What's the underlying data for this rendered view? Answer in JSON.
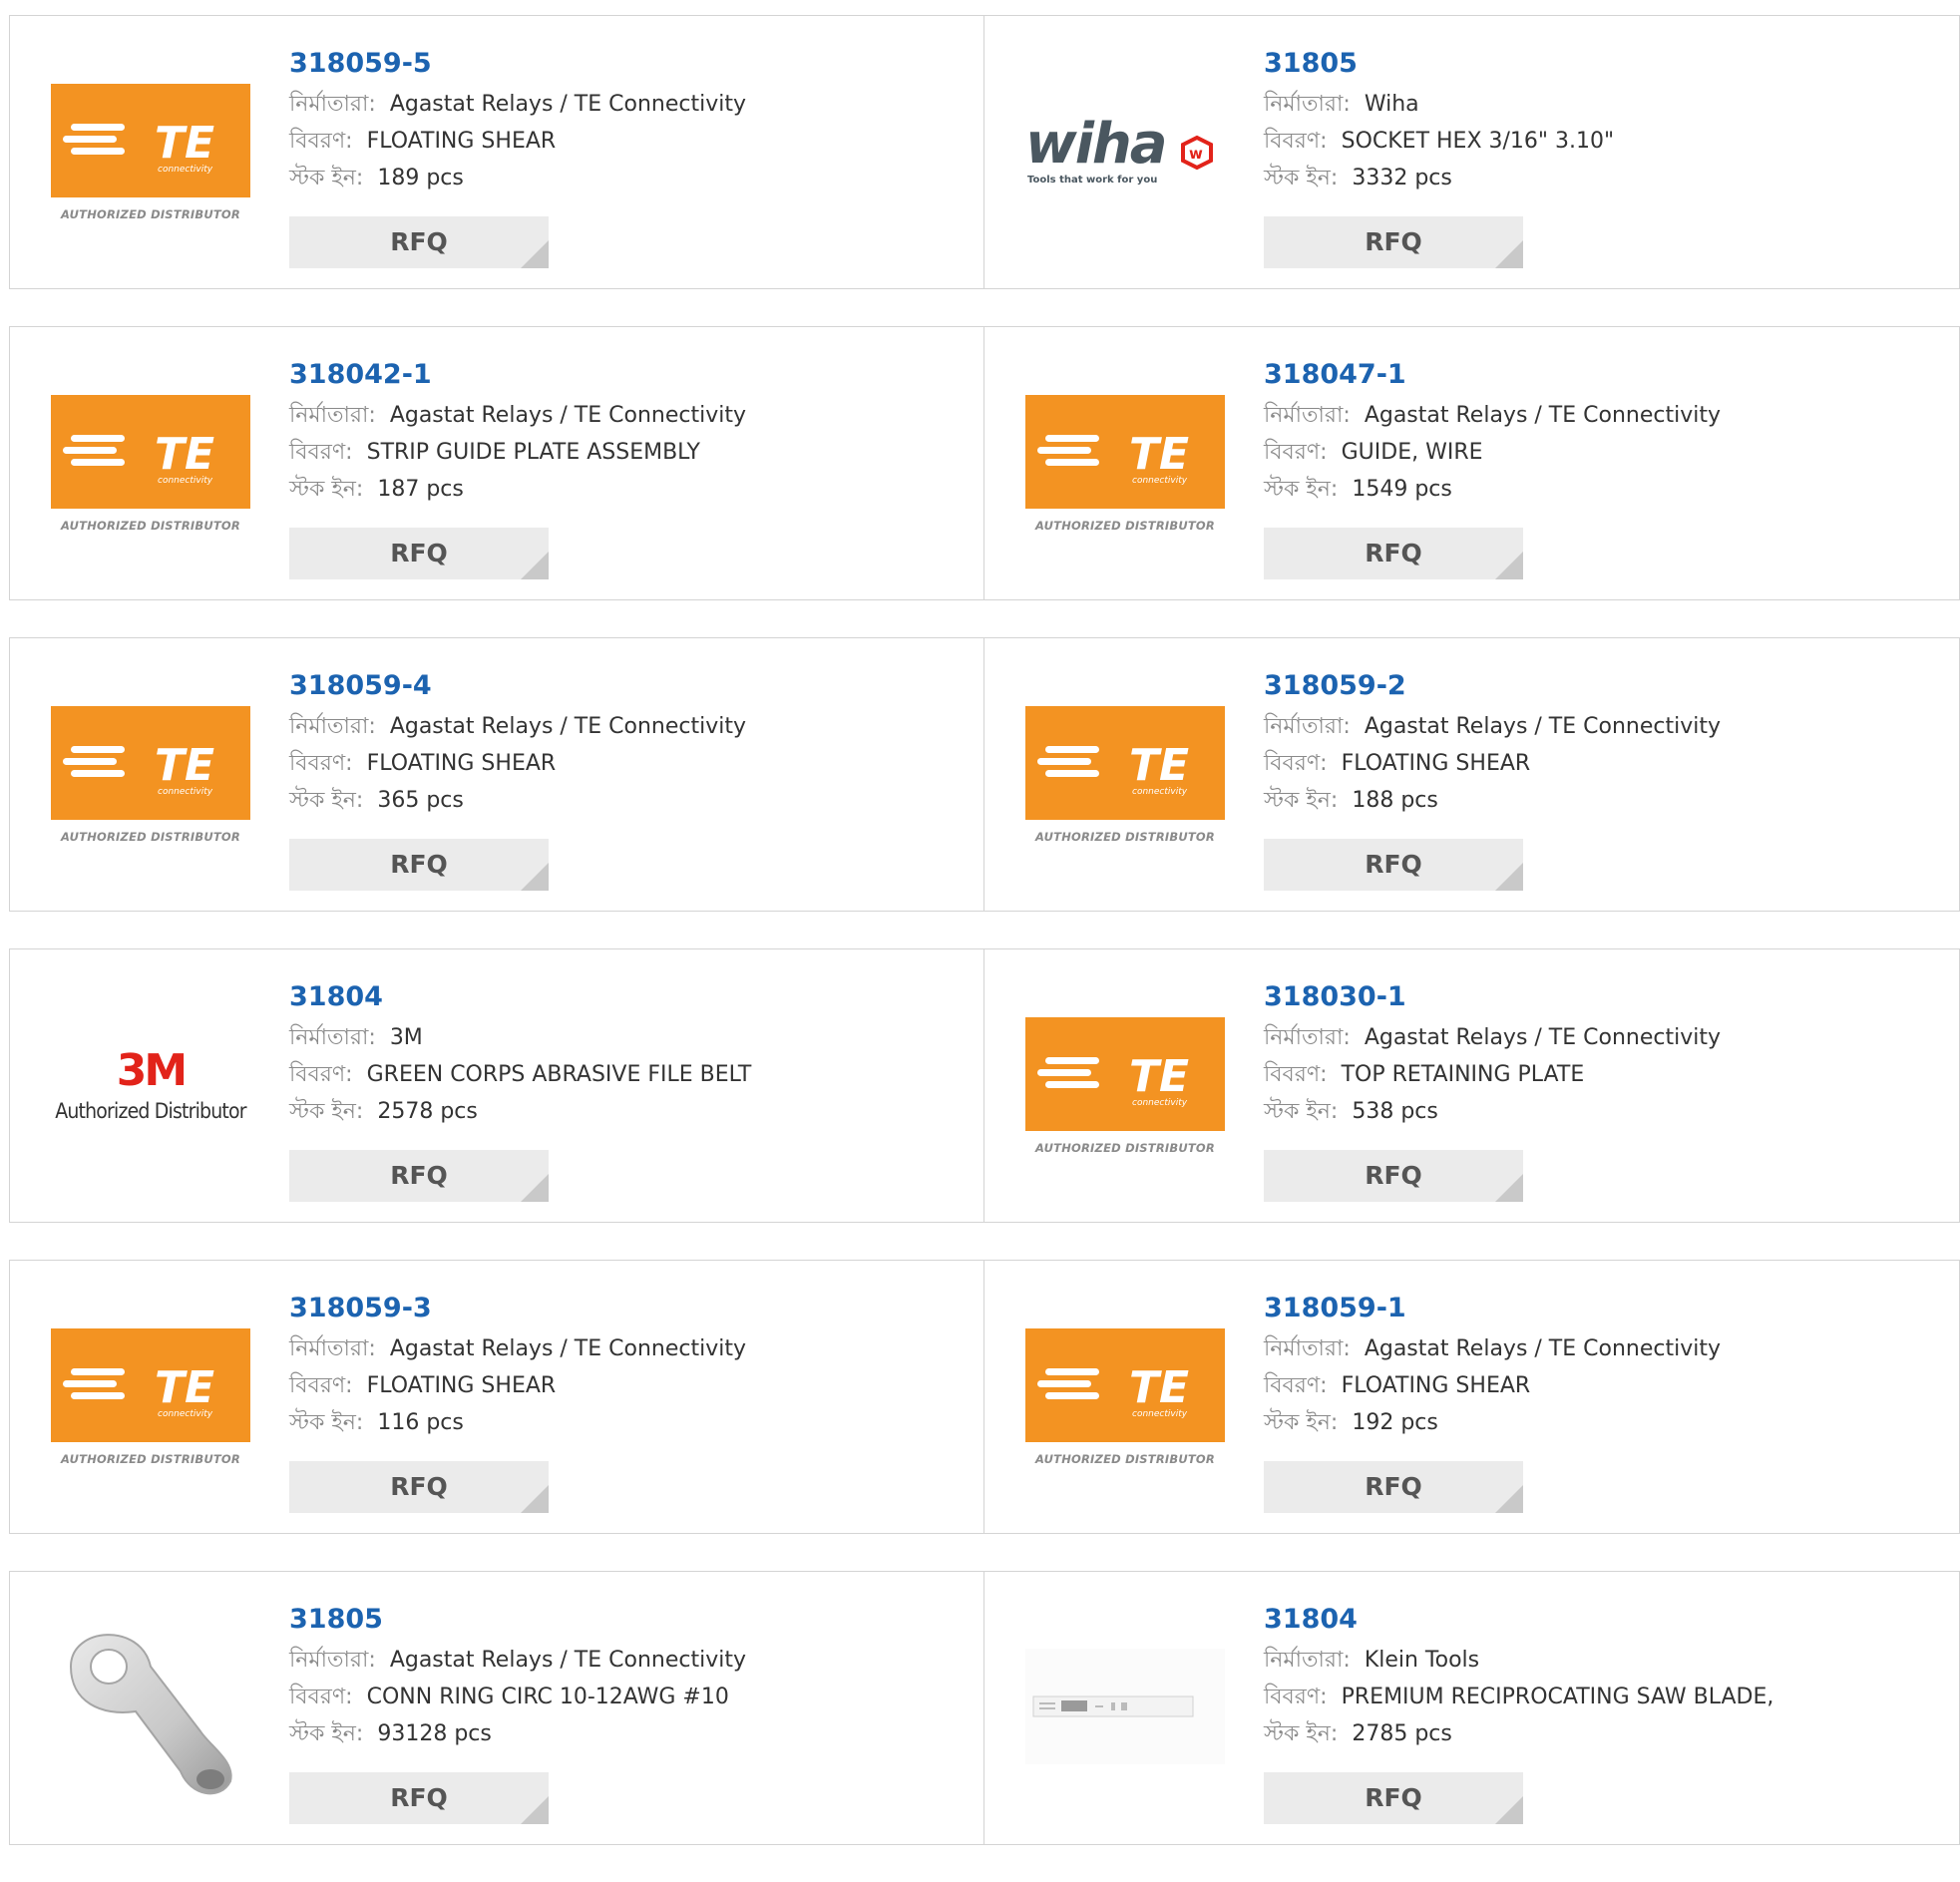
{
  "labels": {
    "manufacturer": "নির্মাতারা:",
    "description": "বিবরণ:",
    "stock": "স্টক ইন:",
    "rfq": "RFQ"
  },
  "logos": {
    "te_text": "TE",
    "te_sub": "connectivity",
    "te_authorized": "AUTHORIZED DISTRIBUTOR",
    "wiha_text": "wiha",
    "wiha_tagline": "Tools that work for you",
    "m3_text": "3M",
    "m3_authorized": "Authorized Distributor"
  },
  "products": [
    {
      "part": "318059-5",
      "logo": "te-logo-icon",
      "manufacturer": "Agastat Relays / TE Connectivity",
      "description": "FLOATING SHEAR",
      "stock": "189 pcs"
    },
    {
      "part": "31805",
      "logo": "wiha-logo-icon",
      "manufacturer": "Wiha",
      "description": "SOCKET HEX 3/16\" 3.10\"",
      "stock": "3332 pcs"
    },
    {
      "part": "318042-1",
      "logo": "te-logo-icon",
      "manufacturer": "Agastat Relays / TE Connectivity",
      "description": "STRIP GUIDE PLATE ASSEMBLY",
      "stock": "187 pcs"
    },
    {
      "part": "318047-1",
      "logo": "te-logo-icon",
      "manufacturer": "Agastat Relays / TE Connectivity",
      "description": "GUIDE, WIRE",
      "stock": "1549 pcs"
    },
    {
      "part": "318059-4",
      "logo": "te-logo-icon",
      "manufacturer": "Agastat Relays / TE Connectivity",
      "description": "FLOATING SHEAR",
      "stock": "365 pcs"
    },
    {
      "part": "318059-2",
      "logo": "te-logo-icon",
      "manufacturer": "Agastat Relays / TE Connectivity",
      "description": "FLOATING SHEAR",
      "stock": "188 pcs"
    },
    {
      "part": "31804",
      "logo": "3m-logo-icon",
      "manufacturer": "3M",
      "description": "GREEN CORPS ABRASIVE FILE BELT",
      "stock": "2578 pcs"
    },
    {
      "part": "318030-1",
      "logo": "te-logo-icon",
      "manufacturer": "Agastat Relays / TE Connectivity",
      "description": "TOP RETAINING PLATE",
      "stock": "538 pcs"
    },
    {
      "part": "318059-3",
      "logo": "te-logo-icon",
      "manufacturer": "Agastat Relays / TE Connectivity",
      "description": "FLOATING SHEAR",
      "stock": "116 pcs"
    },
    {
      "part": "318059-1",
      "logo": "te-logo-icon",
      "manufacturer": "Agastat Relays / TE Connectivity",
      "description": "FLOATING SHEAR",
      "stock": "192 pcs"
    },
    {
      "part": "31805",
      "logo": "ring-terminal-image-icon",
      "manufacturer": "Agastat Relays / TE Connectivity",
      "description": "CONN RING CIRC 10-12AWG #10",
      "stock": "93128 pcs"
    },
    {
      "part": "31804",
      "logo": "saw-blade-image-icon",
      "manufacturer": "Klein Tools",
      "description": "PREMIUM RECIPROCATING SAW BLADE,",
      "stock": "2785 pcs"
    }
  ],
  "colors": {
    "te_orange": "#f39322",
    "part_link": "#1c63b0",
    "wiha_red": "#e2231a",
    "rfq_bg": "#ebebeb"
  }
}
